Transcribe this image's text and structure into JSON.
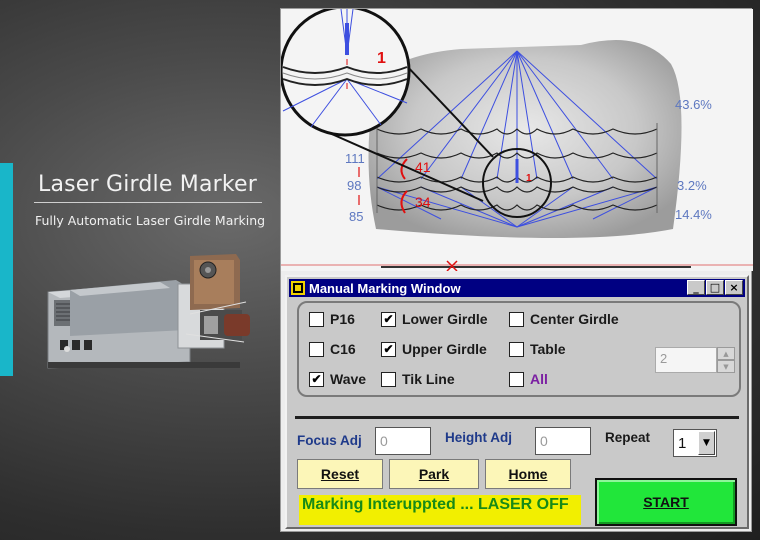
{
  "brand": {
    "title": "Laser Girdle Marker",
    "subtitle": "Fully Automatic Laser Girdle Marking"
  },
  "diagram": {
    "zoom_label": "1",
    "angle_crown": "41",
    "angle_pavilion": "34",
    "crown_percent": "43.6%",
    "girdle_percent": "3.2%",
    "pavilion_percent": "14.4%",
    "depth_top": "111",
    "depth_mid": "98",
    "depth_bottom": "85",
    "center_mark": "1"
  },
  "window": {
    "title": "Manual Marking Window",
    "minimize_label": "_",
    "maximize_label": "□",
    "close_label": "×"
  },
  "options": [
    {
      "label": "P16",
      "checked": false
    },
    {
      "label": "Lower Girdle",
      "checked": true
    },
    {
      "label": "Center Girdle",
      "checked": false
    },
    {
      "label": "C16",
      "checked": false
    },
    {
      "label": "Upper Girdle",
      "checked": true
    },
    {
      "label": "Table",
      "checked": false
    },
    {
      "label": "Wave",
      "checked": true
    },
    {
      "label": "Tik Line",
      "checked": false
    },
    {
      "label": "All",
      "checked": false
    }
  ],
  "spinner_value": "2",
  "adjust": {
    "focus_label": "Focus Adj",
    "focus_value": "0",
    "height_label": "Height Adj",
    "height_value": "0",
    "repeat_label": "Repeat",
    "repeat_value": "1"
  },
  "buttons": {
    "reset": "Reset",
    "park": "Park",
    "home": "Home",
    "start": "START"
  },
  "status_text": "Marking Interuppted ... LASER OFF",
  "colors": {
    "accent": "#19b6c9",
    "title_bar": "#000082",
    "status_bg": "#f2ef00",
    "status_text": "#178a17",
    "start_bg": "#21e63a",
    "button_bg": "#fcf6b8",
    "diagram_lines": "#3d4fe0",
    "angle_marks": "#e01010"
  }
}
